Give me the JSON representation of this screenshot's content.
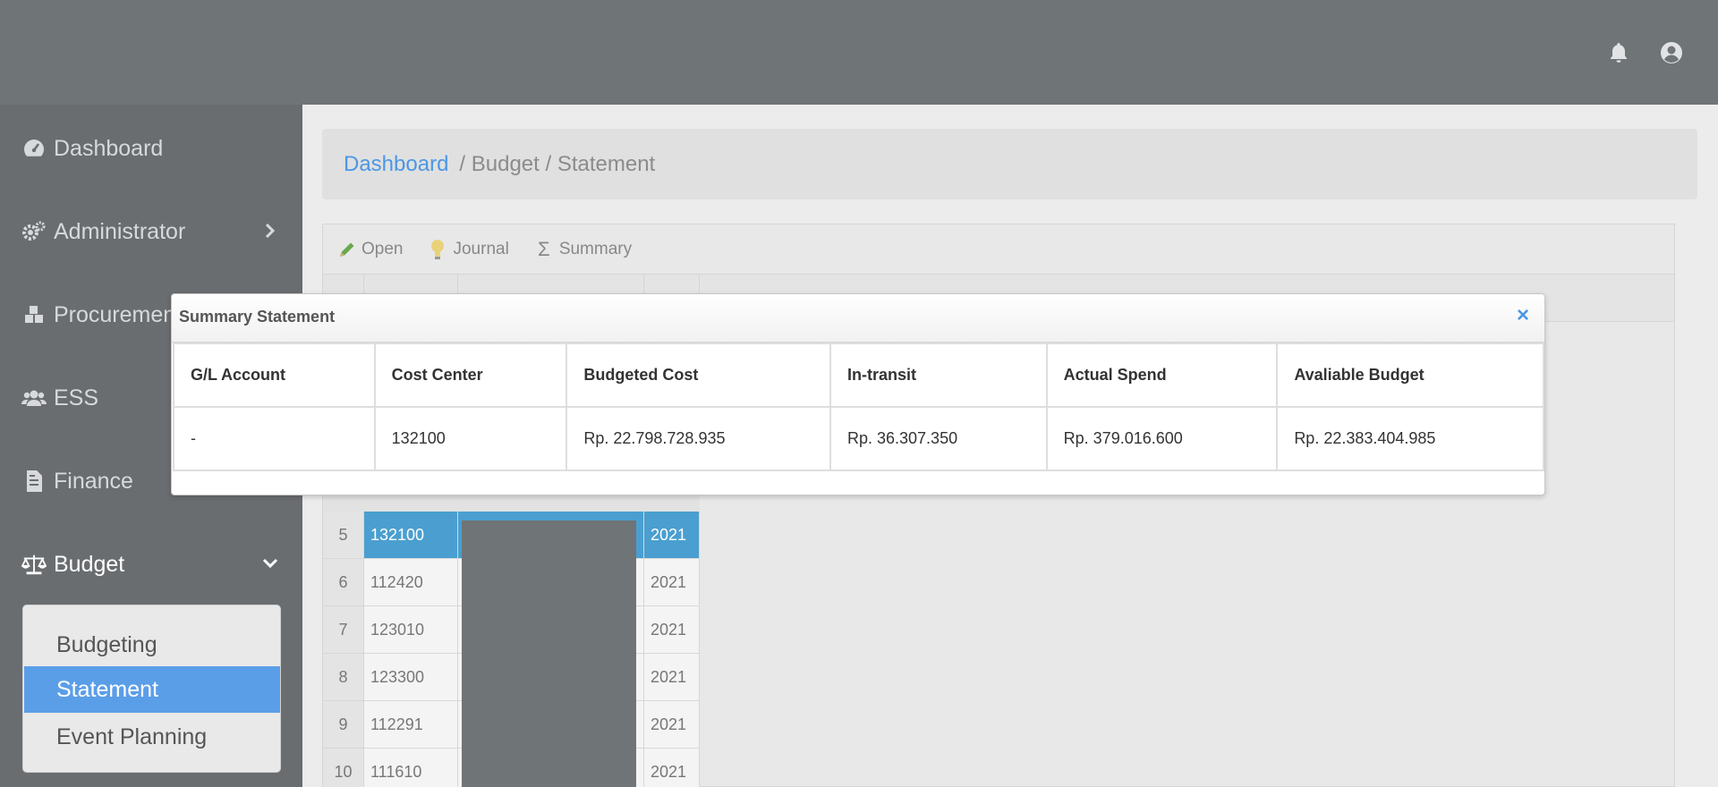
{
  "topbar": {
    "icons": [
      "bell-icon",
      "user-circle-icon"
    ]
  },
  "sidebar": {
    "items": [
      {
        "label": "Dashboard",
        "icon": "tachometer-icon"
      },
      {
        "label": "Administrator",
        "icon": "cogs-icon"
      },
      {
        "label": "Procurement",
        "icon": "cubes-icon"
      },
      {
        "label": "ESS",
        "icon": "users-icon"
      },
      {
        "label": "Finance",
        "icon": "file-invoice-icon"
      },
      {
        "label": "Budget",
        "icon": "balance-scale-icon"
      }
    ],
    "budget_submenu": [
      "Budgeting",
      "Statement",
      "Event Planning"
    ],
    "selected_submenu": "Statement"
  },
  "breadcrumb": {
    "home": "Dashboard",
    "path": "/ Budget / Statement"
  },
  "toolbar": {
    "open": "Open",
    "journal": "Journal",
    "summary": "Summary"
  },
  "grid": {
    "rows": [
      {
        "num": "5",
        "cost_center": "132100",
        "period": "2021",
        "selected": true
      },
      {
        "num": "6",
        "cost_center": "112420",
        "period": "2021"
      },
      {
        "num": "7",
        "cost_center": "123010",
        "period": "2021"
      },
      {
        "num": "8",
        "cost_center": "123300",
        "period": "2021"
      },
      {
        "num": "9",
        "cost_center": "112291",
        "period": "2021"
      },
      {
        "num": "10",
        "cost_center": "111610",
        "period": "2021"
      }
    ]
  },
  "modal": {
    "title": "Summary Statement",
    "close": "×",
    "columns": [
      "G/L Account",
      "Cost Center",
      "Budgeted Cost",
      "In-transit",
      "Actual Spend",
      "Avaliable Budget"
    ],
    "row": [
      "-",
      "132100",
      "Rp. 22.798.728.935",
      "Rp. 36.307.350",
      "Rp. 379.016.600",
      "Rp. 22.383.404.985"
    ]
  },
  "colors": {
    "topbar": "#6f7477",
    "sidebar": "#6a6d70",
    "accent": "#4c97e3",
    "selected_row": "#4a9fd0"
  }
}
